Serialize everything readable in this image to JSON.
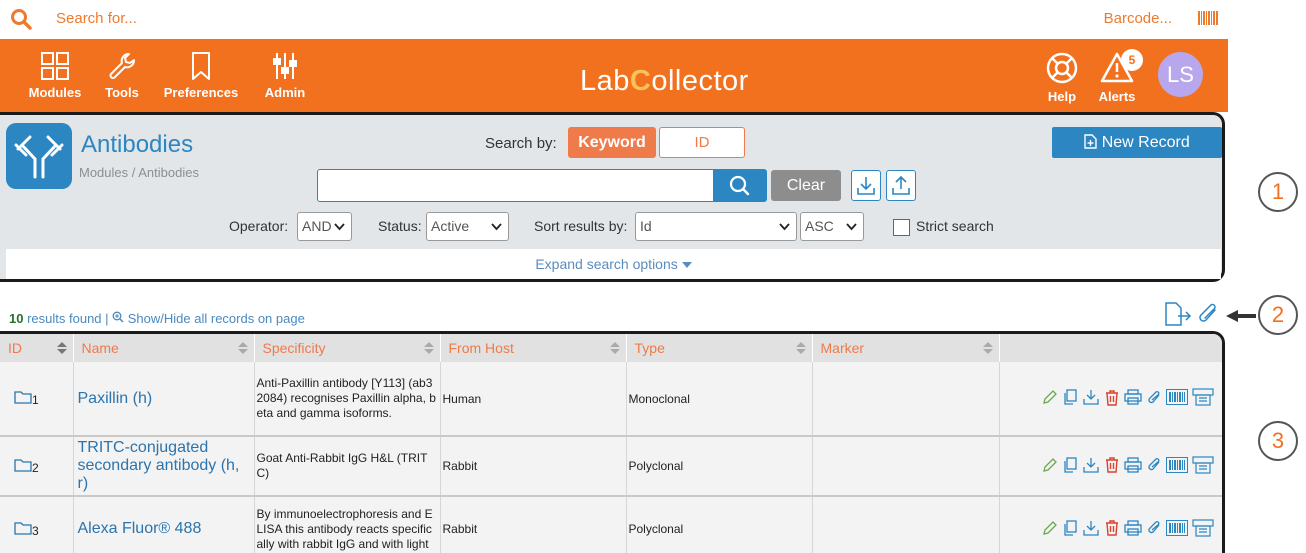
{
  "topbar": {
    "search_placeholder": "Search for...",
    "barcode_label": "Barcode..."
  },
  "header": {
    "nav": [
      {
        "label": "Modules"
      },
      {
        "label": "Tools"
      },
      {
        "label": "Preferences"
      },
      {
        "label": "Admin"
      }
    ],
    "logo_left": "Lab",
    "logo_right": "ollector",
    "help_label": "Help",
    "alerts_label": "Alerts",
    "alerts_count": "5",
    "avatar_initials": "LS",
    "accent_color": "#f2711f"
  },
  "panel": {
    "module_title": "Antibodies",
    "breadcrumb": "Modules / Antibodies",
    "search_by_label": "Search by:",
    "keyword_label": "Keyword",
    "id_label": "ID",
    "new_record_label": "New Record",
    "search_value": "",
    "clear_label": "Clear",
    "operator_label": "Operator:",
    "operator_value": "AND",
    "status_label": "Status:",
    "status_value": "Active",
    "sort_label": "Sort results by:",
    "sort_value": "Id",
    "order_value": "ASC",
    "strict_label": "Strict search",
    "expand_label": "Expand search options"
  },
  "results": {
    "count": "10",
    "found_label": " results found |",
    "toggle_label": "Show/Hide all records on page"
  },
  "callouts": [
    "1",
    "2",
    "3"
  ],
  "table": {
    "columns": [
      "ID",
      "Name",
      "Specificity",
      "From Host",
      "Type",
      "Marker"
    ],
    "rows": [
      {
        "id": "1",
        "name": "Paxillin (h)",
        "specificity": "Anti-Paxillin antibody [Y113] (ab32084) recognises Paxillin alpha, beta and gamma isoforms.",
        "host": "Human",
        "type": "Monoclonal",
        "marker": ""
      },
      {
        "id": "2",
        "name": "TRITC-conjugated secondary antibody (h, r)",
        "specificity": "Goat Anti-Rabbit IgG H&L (TRITC)",
        "host": "Rabbit",
        "type": "Polyclonal",
        "marker": ""
      },
      {
        "id": "3",
        "name": "Alexa Fluor® 488",
        "specificity": "By immunoelectrophoresis and ELISA this antibody reacts specifically with rabbit IgG and with light",
        "host": "Rabbit",
        "type": "Polyclonal",
        "marker": ""
      }
    ]
  }
}
